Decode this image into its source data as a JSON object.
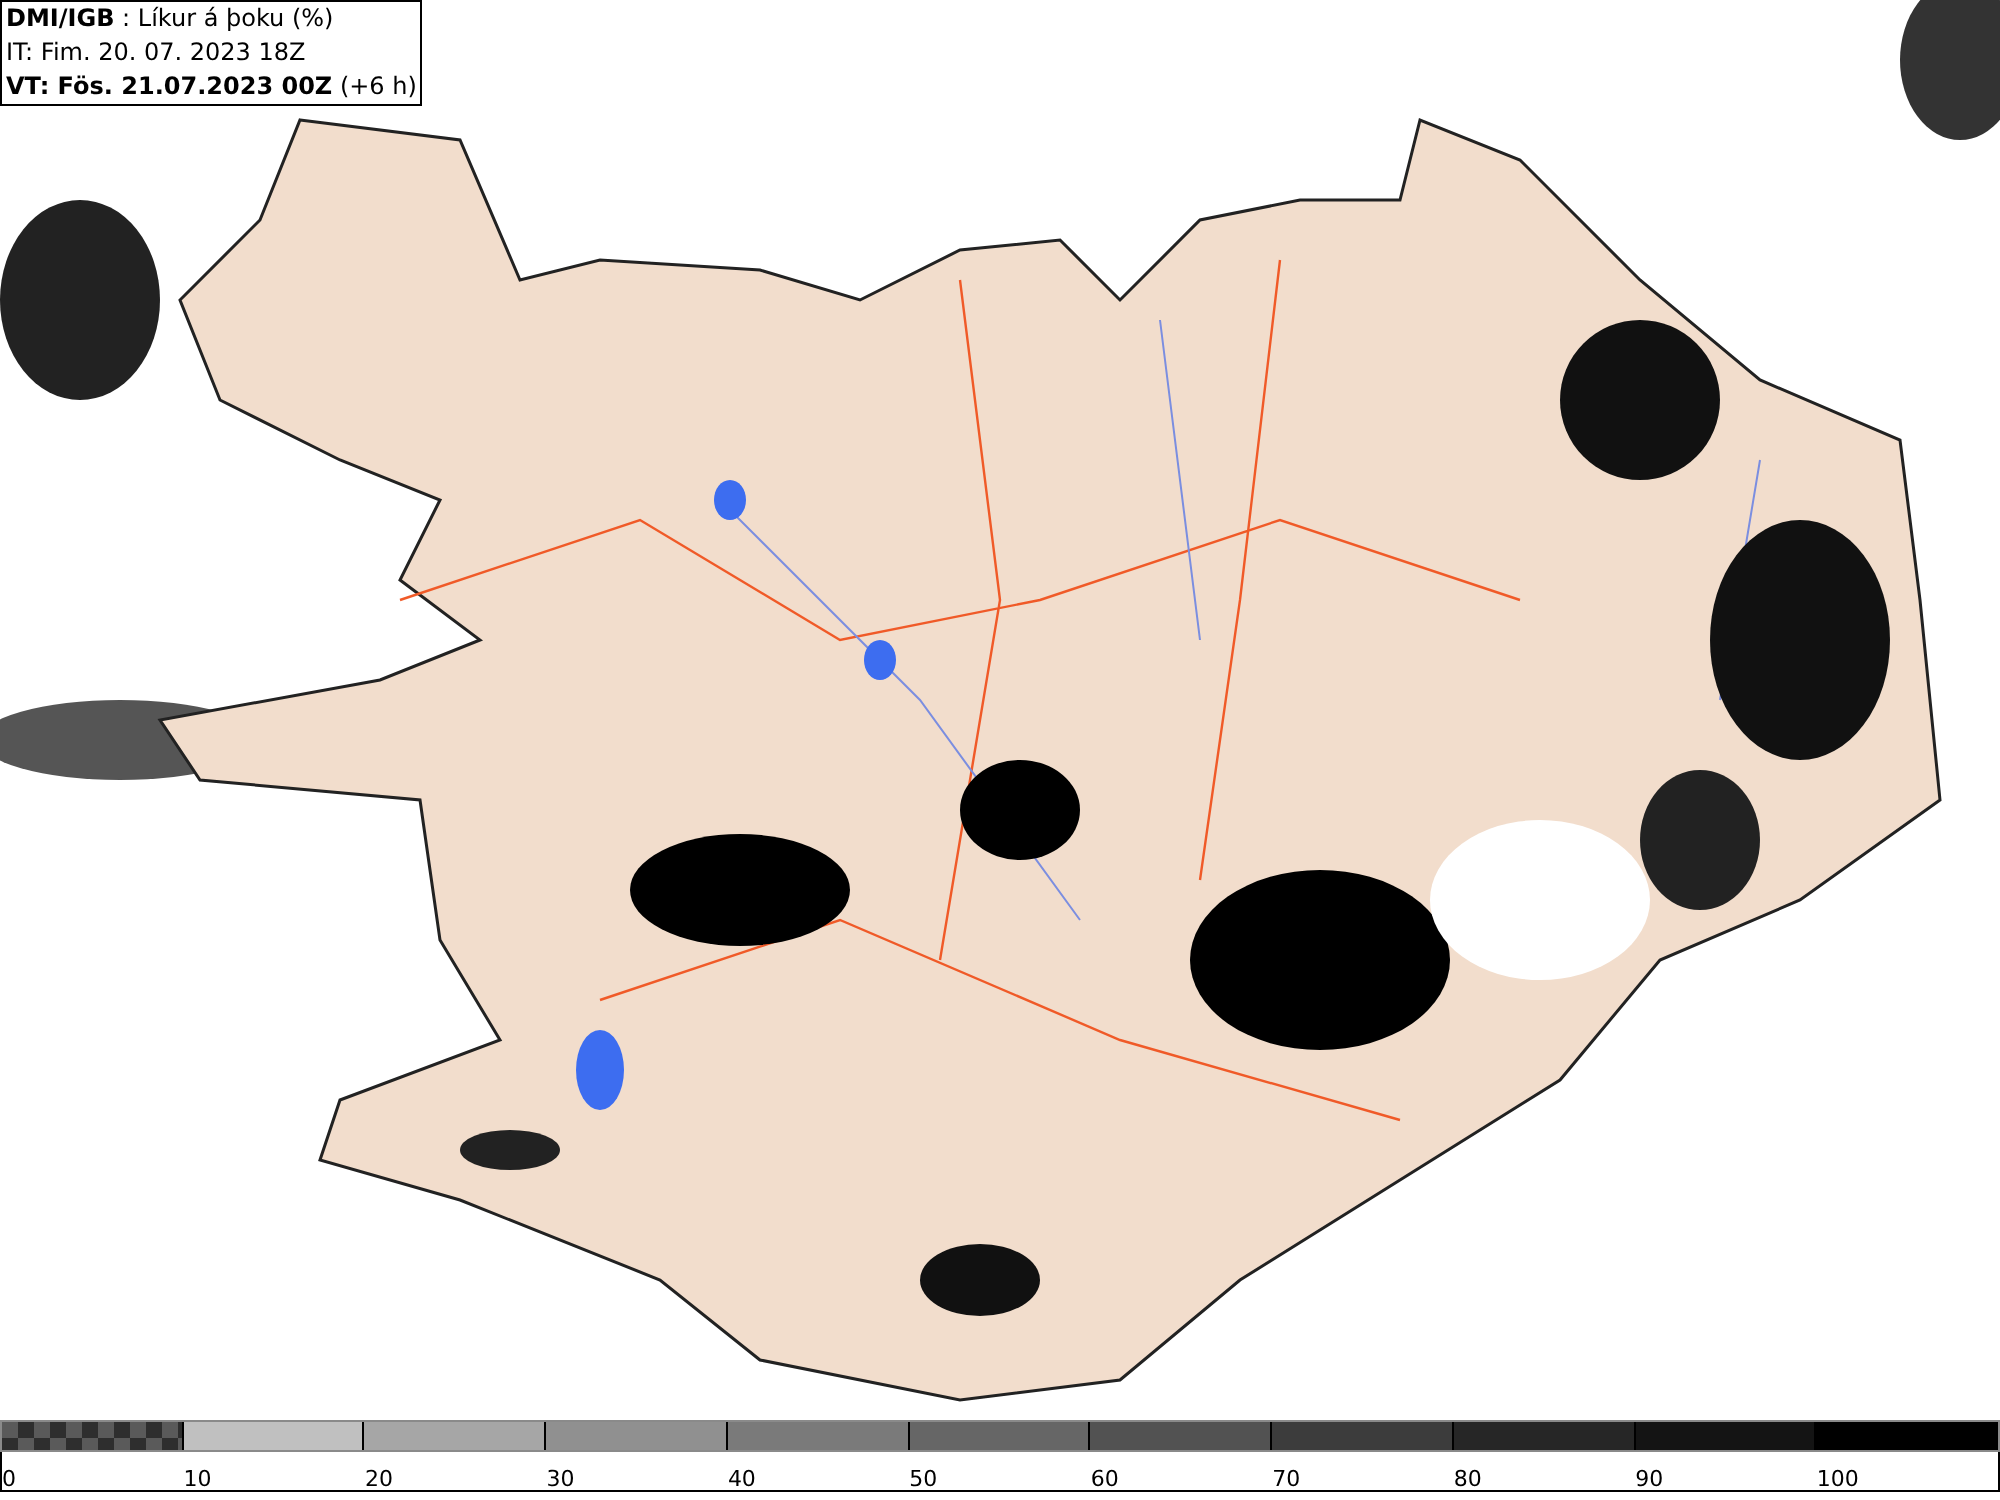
{
  "title_box": {
    "lines": [
      "**DMI/IGB** : Líkur á þoku (%)",
      "IT: Fim. 20. 07. 2023 18Z",
      "**VT: Fös. 21.07.2023 00Z** (+6 h)"
    ]
  },
  "legend": {
    "segments": [
      {
        "kind": "checker",
        "color": "#5a5a5a"
      },
      {
        "kind": "solid",
        "color": "#c0c0c0"
      },
      {
        "kind": "solid",
        "color": "#a6a6a6"
      },
      {
        "kind": "solid",
        "color": "#909090"
      },
      {
        "kind": "solid",
        "color": "#7a7a7a"
      },
      {
        "kind": "solid",
        "color": "#666666"
      },
      {
        "kind": "solid",
        "color": "#525252"
      },
      {
        "kind": "solid",
        "color": "#3c3c3c"
      },
      {
        "kind": "solid",
        "color": "#262626"
      },
      {
        "kind": "solid",
        "color": "#141414"
      },
      {
        "kind": "solid",
        "color": "#000000"
      }
    ],
    "labels": [
      "0",
      "10",
      "20",
      "30",
      "40",
      "50",
      "60",
      "70",
      "80",
      "90",
      "100"
    ]
  }
}
